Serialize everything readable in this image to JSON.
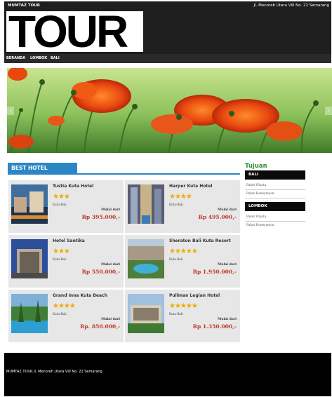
{
  "topbar": {
    "brand": "MUMTAZ TOUR",
    "address": "Jl. Menoreh Utara VIII No. 22 Semarang"
  },
  "logo": {
    "text": "TOUR"
  },
  "nav": {
    "items": [
      "BERANDA",
      "LOMBOK",
      "BALI"
    ]
  },
  "hero": {
    "prev_icon": "chevron-left-icon",
    "next_icon": "chevron-right-icon"
  },
  "best_hotel": {
    "title": "BEST HOTEL",
    "hotels": [
      {
        "name": "Tustia Kuta Hotel",
        "stars": "★★★",
        "location": "Kuta-Bali",
        "from_label": "Mulai dari",
        "price": "Rp 395.000,-"
      },
      {
        "name": "Harper Kuta Hotel",
        "stars": "★★★★",
        "location": "Kuta-Bali",
        "from_label": "Mulai dari",
        "price": "Rp 495.000,-"
      },
      {
        "name": "Hotel Santika",
        "stars": "★★★",
        "location": "Kuta-Bali",
        "from_label": "Mulai dari",
        "price": "Rp 550.000,-"
      },
      {
        "name": "Sheraton Bali Kuta Resort",
        "stars": "★★★★★",
        "location": "Kuta-Bali",
        "from_label": "Mulai dari",
        "price": "Rp 1.950.000,-"
      },
      {
        "name": "Grand Inna Kuta Beach",
        "stars": "★★★★",
        "location": "Kuta-Bali",
        "from_label": "Mulai dari",
        "price": "Rp. 850.000,-"
      },
      {
        "name": "Pullman Legian Hotel",
        "stars": "★★★★★",
        "location": "Kuta-Bali",
        "from_label": "Mulai dari",
        "price": "Rp 1.350.000,-"
      }
    ]
  },
  "sidebar": {
    "title": "Tujuan",
    "sections": [
      {
        "heading": "BALI",
        "links": [
          "Paket Wisata",
          "Paket Honeymoon"
        ]
      },
      {
        "heading": "LOMBOK",
        "links": [
          "Paket Wisata",
          "Paket Honeymoon"
        ]
      }
    ]
  },
  "footer": {
    "text": "MUMTAZ TOUR Jl. Menoreh Utara VIII No. 22 Semarang"
  },
  "colors": {
    "accent": "#2a86c5",
    "price": "#c0392b",
    "sidebar_title": "#2e8b3a",
    "header_bg": "#1e1e1e"
  }
}
